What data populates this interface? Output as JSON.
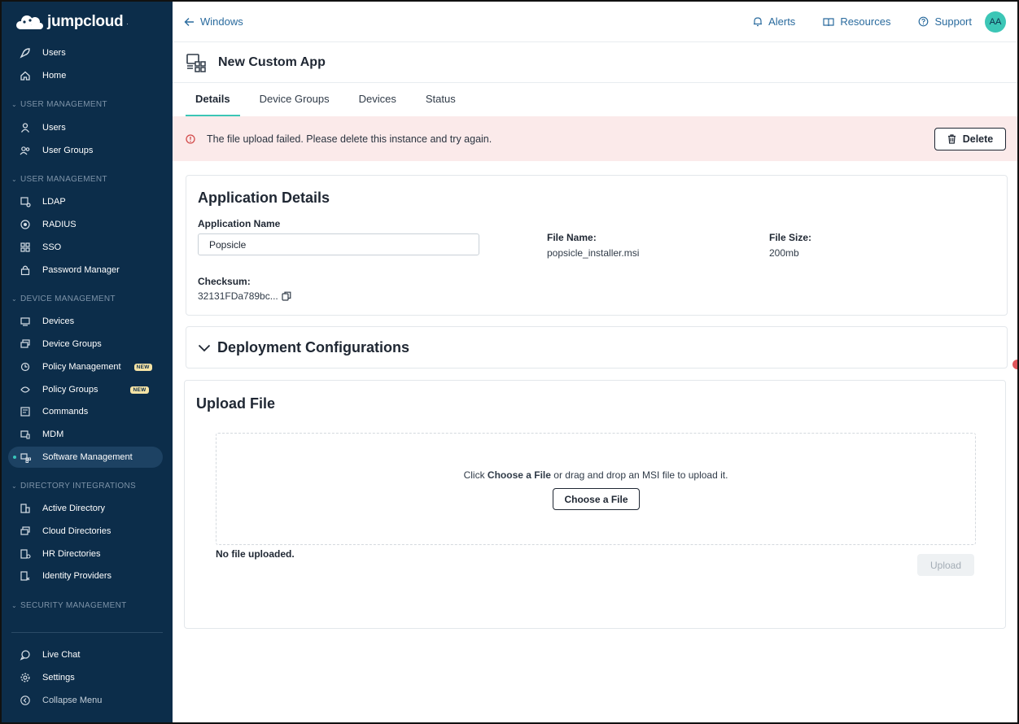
{
  "brand": {
    "name": "jumpcloud",
    "tm": "."
  },
  "sidebar": {
    "top_items": [
      {
        "label": "Users",
        "icon": "rocket-icon"
      },
      {
        "label": "Home",
        "icon": "home-icon"
      }
    ],
    "sections": [
      {
        "title": "USER MANAGEMENT",
        "items": [
          {
            "label": "Users",
            "icon": "user-icon"
          },
          {
            "label": "User Groups",
            "icon": "user-group-icon"
          }
        ]
      },
      {
        "title": "USER MANAGEMENT",
        "items": [
          {
            "label": "LDAP",
            "icon": "ldap-icon"
          },
          {
            "label": "RADIUS",
            "icon": "radius-icon"
          },
          {
            "label": "SSO",
            "icon": "sso-icon"
          },
          {
            "label": "Password Manager",
            "icon": "password-manager-icon"
          }
        ]
      },
      {
        "title": "DEVICE MANAGEMENT",
        "items": [
          {
            "label": "Devices",
            "icon": "devices-icon"
          },
          {
            "label": "Device Groups",
            "icon": "device-groups-icon"
          },
          {
            "label": "Policy Management",
            "icon": "policy-management-icon",
            "badge": "NEW"
          },
          {
            "label": "Policy Groups",
            "icon": "policy-groups-icon",
            "badge": "NEW"
          },
          {
            "label": "Commands",
            "icon": "commands-icon"
          },
          {
            "label": "MDM",
            "icon": "mdm-icon"
          },
          {
            "label": "Software Management",
            "icon": "software-management-icon",
            "active": true
          }
        ]
      },
      {
        "title": "DIRECTORY INTEGRATIONS",
        "items": [
          {
            "label": "Active Directory",
            "icon": "active-directory-icon"
          },
          {
            "label": "Cloud Directories",
            "icon": "cloud-directories-icon"
          },
          {
            "label": "HR Directories",
            "icon": "hr-directories-icon"
          },
          {
            "label": "Identity Providers",
            "icon": "identity-providers-icon"
          }
        ]
      },
      {
        "title": "SECURITY MANAGEMENT",
        "items": []
      }
    ],
    "bottom_items": [
      {
        "label": "Live Chat",
        "icon": "chat-icon"
      },
      {
        "label": "Settings",
        "icon": "gear-icon"
      },
      {
        "label": "Collapse Menu",
        "icon": "collapse-icon"
      }
    ]
  },
  "topbar": {
    "back_label": "Windows",
    "alerts": "Alerts",
    "resources": "Resources",
    "support": "Support",
    "avatar_initials": "AA"
  },
  "page": {
    "title": "New Custom App",
    "tabs": [
      "Details",
      "Device Groups",
      "Devices",
      "Status"
    ],
    "active_tab": "Details"
  },
  "alert": {
    "message": "The file upload failed. Please delete this instance and try again.",
    "delete_label": "Delete"
  },
  "details": {
    "title": "Application Details",
    "app_name_label": "Application Name",
    "app_name_value": "Popsicle",
    "file_name_label": "File Name:",
    "file_name_value": "popsicle_installer.msi",
    "file_size_label": "File Size:",
    "file_size_value": "200mb",
    "checksum_label": "Checksum:",
    "checksum_value": "32131FDa789bc..."
  },
  "deployment": {
    "title": "Deployment Configurations"
  },
  "upload": {
    "title": "Upload File",
    "drop_prefix": "Click ",
    "drop_bold": "Choose a File",
    "drop_suffix": " or drag and drop an MSI file to upload it.",
    "choose_label": "Choose a File",
    "no_file": "No file uploaded.",
    "upload_label": "Upload"
  },
  "colors": {
    "sidebar_bg": "#0c2d4a",
    "accent": "#3cc6b6",
    "link": "#2a6b9e",
    "alert_bg": "#fbeaea",
    "alert_icon": "#d24b4b"
  }
}
